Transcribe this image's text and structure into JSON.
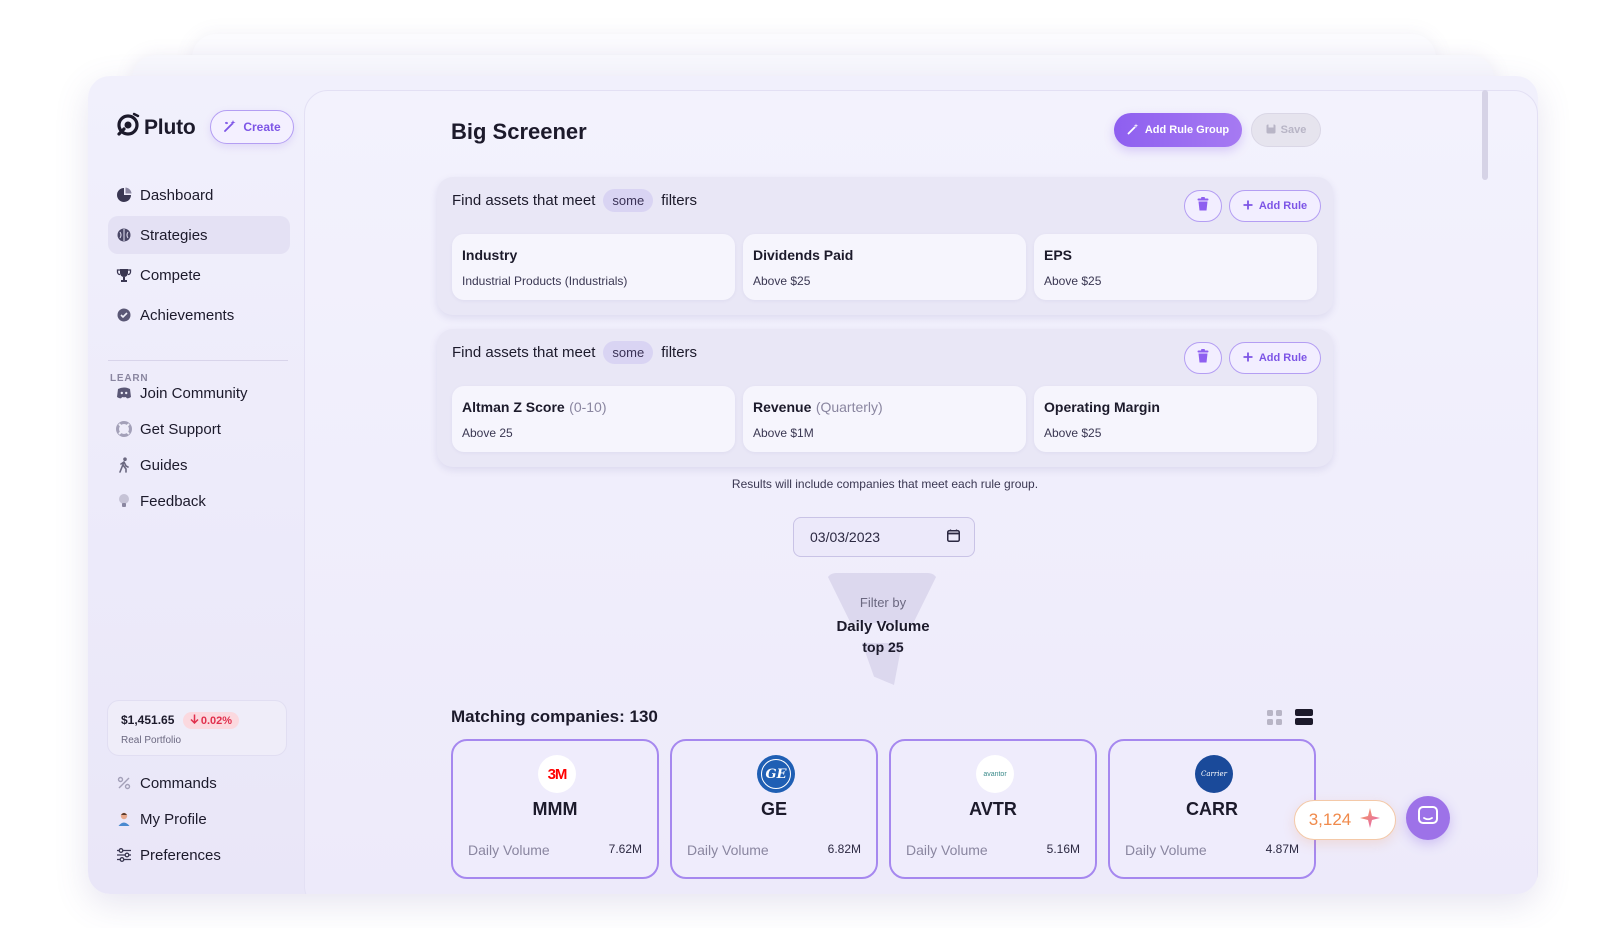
{
  "app": {
    "name": "Pluto",
    "create_label": "Create"
  },
  "sidebar": {
    "nav": [
      {
        "label": "Dashboard",
        "icon": "pie-chart-icon"
      },
      {
        "label": "Strategies",
        "icon": "brain-icon",
        "active": true
      },
      {
        "label": "Compete",
        "icon": "trophy-icon"
      },
      {
        "label": "Achievements",
        "icon": "badge-icon"
      }
    ],
    "learn_label": "LEARN",
    "learn": [
      {
        "label": "Join Community",
        "icon": "discord-icon"
      },
      {
        "label": "Get Support",
        "icon": "lifebuoy-icon"
      },
      {
        "label": "Guides",
        "icon": "walking-icon"
      },
      {
        "label": "Feedback",
        "icon": "lightbulb-icon"
      }
    ],
    "portfolio": {
      "value": "$1,451.65",
      "change": "0.02%",
      "label": "Real Portfolio"
    },
    "bottom": [
      {
        "label": "Commands",
        "icon": "percent-icon"
      },
      {
        "label": "My Profile",
        "icon": "person-icon"
      },
      {
        "label": "Preferences",
        "icon": "sliders-icon"
      }
    ]
  },
  "main": {
    "title": "Big Screener",
    "add_rule_group_label": "Add Rule Group",
    "save_label": "Save",
    "rule_groups": [
      {
        "prefix": "Find assets that meet",
        "mode": "some",
        "suffix": "filters",
        "add_rule_label": "Add Rule",
        "rules": [
          {
            "title": "Industry",
            "subtitle": "",
            "value": "Industrial Products (Industrials)"
          },
          {
            "title": "Dividends Paid",
            "subtitle": "",
            "value": "Above $25"
          },
          {
            "title": "EPS",
            "subtitle": "",
            "value": "Above $25"
          }
        ]
      },
      {
        "prefix": "Find assets that meet",
        "mode": "some",
        "suffix": "filters",
        "add_rule_label": "Add Rule",
        "rules": [
          {
            "title": "Altman Z Score",
            "subtitle": "(0-10)",
            "value": "Above 25"
          },
          {
            "title": "Revenue",
            "subtitle": "(Quarterly)",
            "value": "Above $1M"
          },
          {
            "title": "Operating Margin",
            "subtitle": "",
            "value": "Above $25"
          }
        ]
      }
    ],
    "results_note": "Results will include companies that meet each rule group.",
    "date": "03/03/2023",
    "filter": {
      "by_label": "Filter by",
      "name": "Daily Volume",
      "top": "top 25"
    },
    "matching_label": "Matching companies: 130",
    "companies": [
      {
        "ticker": "MMM",
        "logo_text": "3M",
        "metric_label": "Daily Volume",
        "metric_value": "7.62M"
      },
      {
        "ticker": "GE",
        "logo_text": "GE",
        "metric_label": "Daily Volume",
        "metric_value": "6.82M"
      },
      {
        "ticker": "AVTR",
        "logo_text": "avantor",
        "metric_label": "Daily Volume",
        "metric_value": "5.16M"
      },
      {
        "ticker": "CARR",
        "logo_text": "Carrier",
        "metric_label": "Daily Volume",
        "metric_value": "4.87M"
      }
    ]
  },
  "points": "3,124",
  "colors": {
    "accent": "#8e5ff0",
    "accent_light": "#b49ef3",
    "negative": "#e0304d",
    "points": "#f08a4b"
  }
}
